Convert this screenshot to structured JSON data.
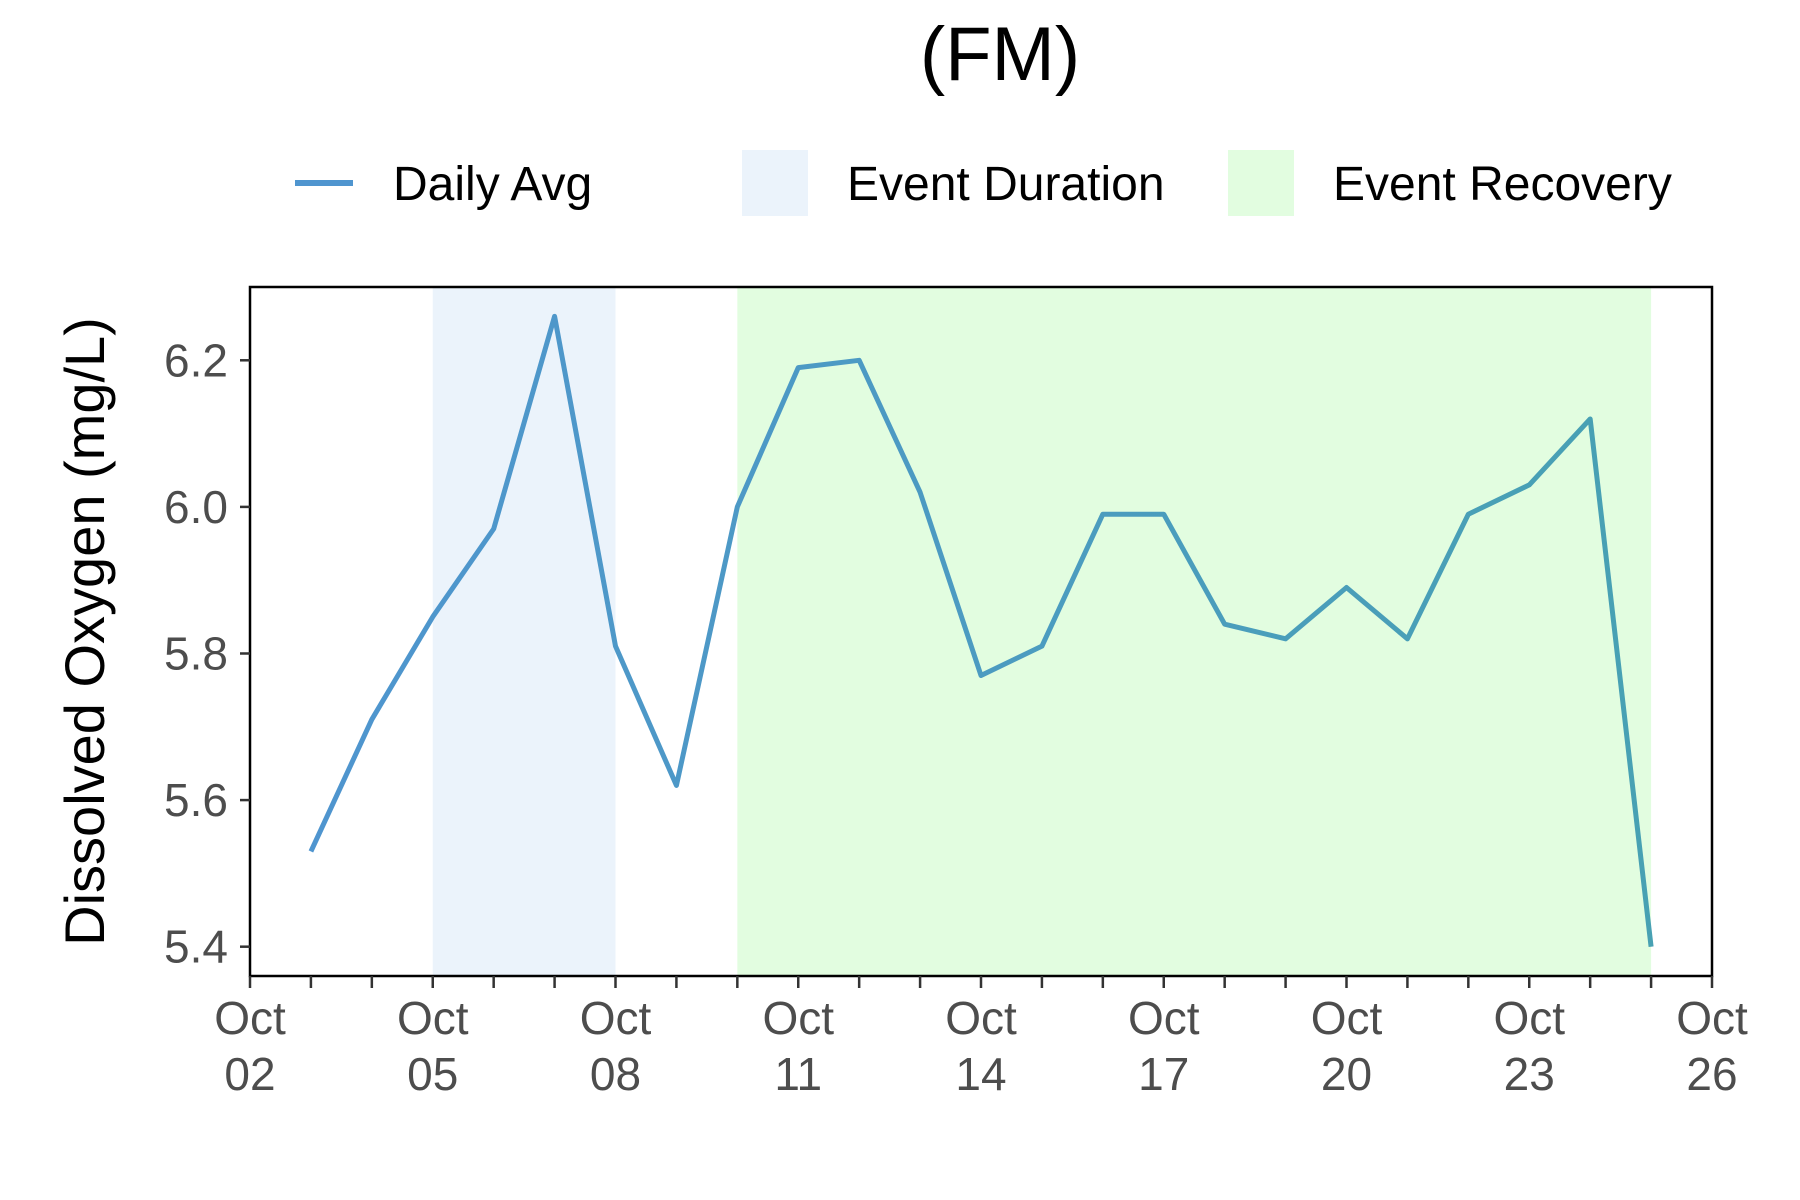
{
  "chart_data": {
    "type": "line",
    "title": "(FM)",
    "xlabel": "",
    "ylabel": "Dissolved Oxygen (mg/L)",
    "legend_position": "top",
    "legend": [
      {
        "label": "Daily Avg",
        "kind": "line",
        "color": "#4f95cf"
      },
      {
        "label": "Event Duration",
        "kind": "fill",
        "color": "#ebf3fb"
      },
      {
        "label": "Event Recovery",
        "kind": "fill",
        "color": "#e2fde0"
      }
    ],
    "x_ticks": [
      {
        "date": "2023-10-02",
        "label": [
          "Oct",
          "02"
        ]
      },
      {
        "date": "2023-10-05",
        "label": [
          "Oct",
          "05"
        ]
      },
      {
        "date": "2023-10-08",
        "label": [
          "Oct",
          "08"
        ]
      },
      {
        "date": "2023-10-11",
        "label": [
          "Oct",
          "11"
        ]
      },
      {
        "date": "2023-10-14",
        "label": [
          "Oct",
          "14"
        ]
      },
      {
        "date": "2023-10-17",
        "label": [
          "Oct",
          "17"
        ]
      },
      {
        "date": "2023-10-20",
        "label": [
          "Oct",
          "20"
        ]
      },
      {
        "date": "2023-10-23",
        "label": [
          "Oct",
          "23"
        ]
      },
      {
        "date": "2023-10-26",
        "label": [
          "Oct",
          "26"
        ]
      }
    ],
    "xlim": [
      "2023-10-02",
      "2023-10-26"
    ],
    "y_ticks": [
      "5.4",
      "5.6",
      "5.8",
      "6.0",
      "6.2"
    ],
    "ylim": [
      5.36,
      6.3
    ],
    "grid": false,
    "shaded_regions": [
      {
        "name": "Event Duration",
        "start": "2023-10-05",
        "end": "2023-10-08",
        "color": "#ebf3fb"
      },
      {
        "name": "Event Recovery",
        "start": "2023-10-10",
        "end": "2023-10-25",
        "color": "#e2fde0"
      }
    ],
    "series": [
      {
        "name": "Daily Avg",
        "color_start": "#4f95cf",
        "color_end": "#48a1b3",
        "x": [
          "2023-10-03",
          "2023-10-04",
          "2023-10-05",
          "2023-10-06",
          "2023-10-07",
          "2023-10-08",
          "2023-10-09",
          "2023-10-10",
          "2023-10-11",
          "2023-10-12",
          "2023-10-13",
          "2023-10-14",
          "2023-10-15",
          "2023-10-16",
          "2023-10-17",
          "2023-10-18",
          "2023-10-19",
          "2023-10-20",
          "2023-10-21",
          "2023-10-22",
          "2023-10-23",
          "2023-10-24",
          "2023-10-25"
        ],
        "values": [
          5.53,
          5.71,
          5.85,
          5.97,
          6.26,
          5.81,
          5.62,
          6.0,
          6.19,
          6.2,
          6.02,
          5.77,
          5.81,
          5.99,
          5.99,
          5.84,
          5.82,
          5.89,
          5.82,
          5.99,
          6.03,
          6.12,
          5.4
        ]
      }
    ]
  }
}
